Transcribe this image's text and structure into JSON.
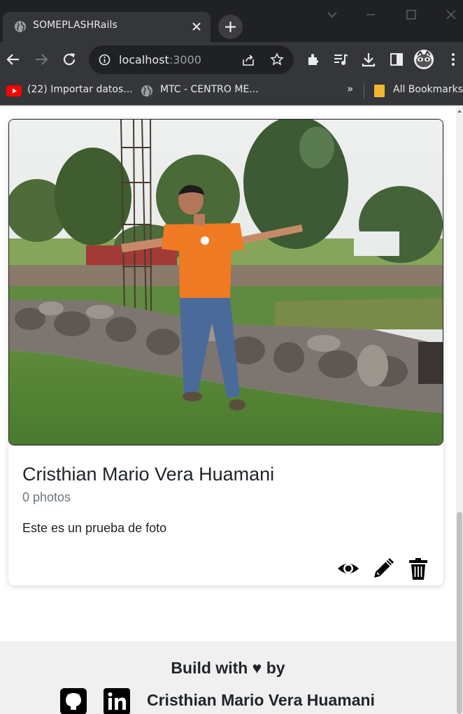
{
  "browser": {
    "tab_title": "SOMEPLASHRails",
    "url_host": "localhost",
    "url_port": ":3000",
    "bookmarks": [
      {
        "label": "(22) Importar datos..."
      },
      {
        "label": "MTC - CENTRO ME..."
      }
    ],
    "overflow_label": "»",
    "all_bookmarks_label": "All Bookmarks"
  },
  "card": {
    "title": "Cristhian Mario Vera Huamani",
    "subtitle": "0 photos",
    "description": "Este es un prueba de foto",
    "actions": [
      "eye-icon",
      "pencil-icon",
      "trash-icon"
    ]
  },
  "footer": {
    "build_line": "Build with ♥ by",
    "author": "Cristhian Mario Vera Huamani",
    "social": [
      "github-icon",
      "linkedin-icon"
    ]
  },
  "colors": {
    "chrome_dark": "#202124",
    "chrome_tab": "#35363a",
    "text_primary": "#212529",
    "text_muted": "#6c757d",
    "footer_bg": "#f0f0f0"
  }
}
